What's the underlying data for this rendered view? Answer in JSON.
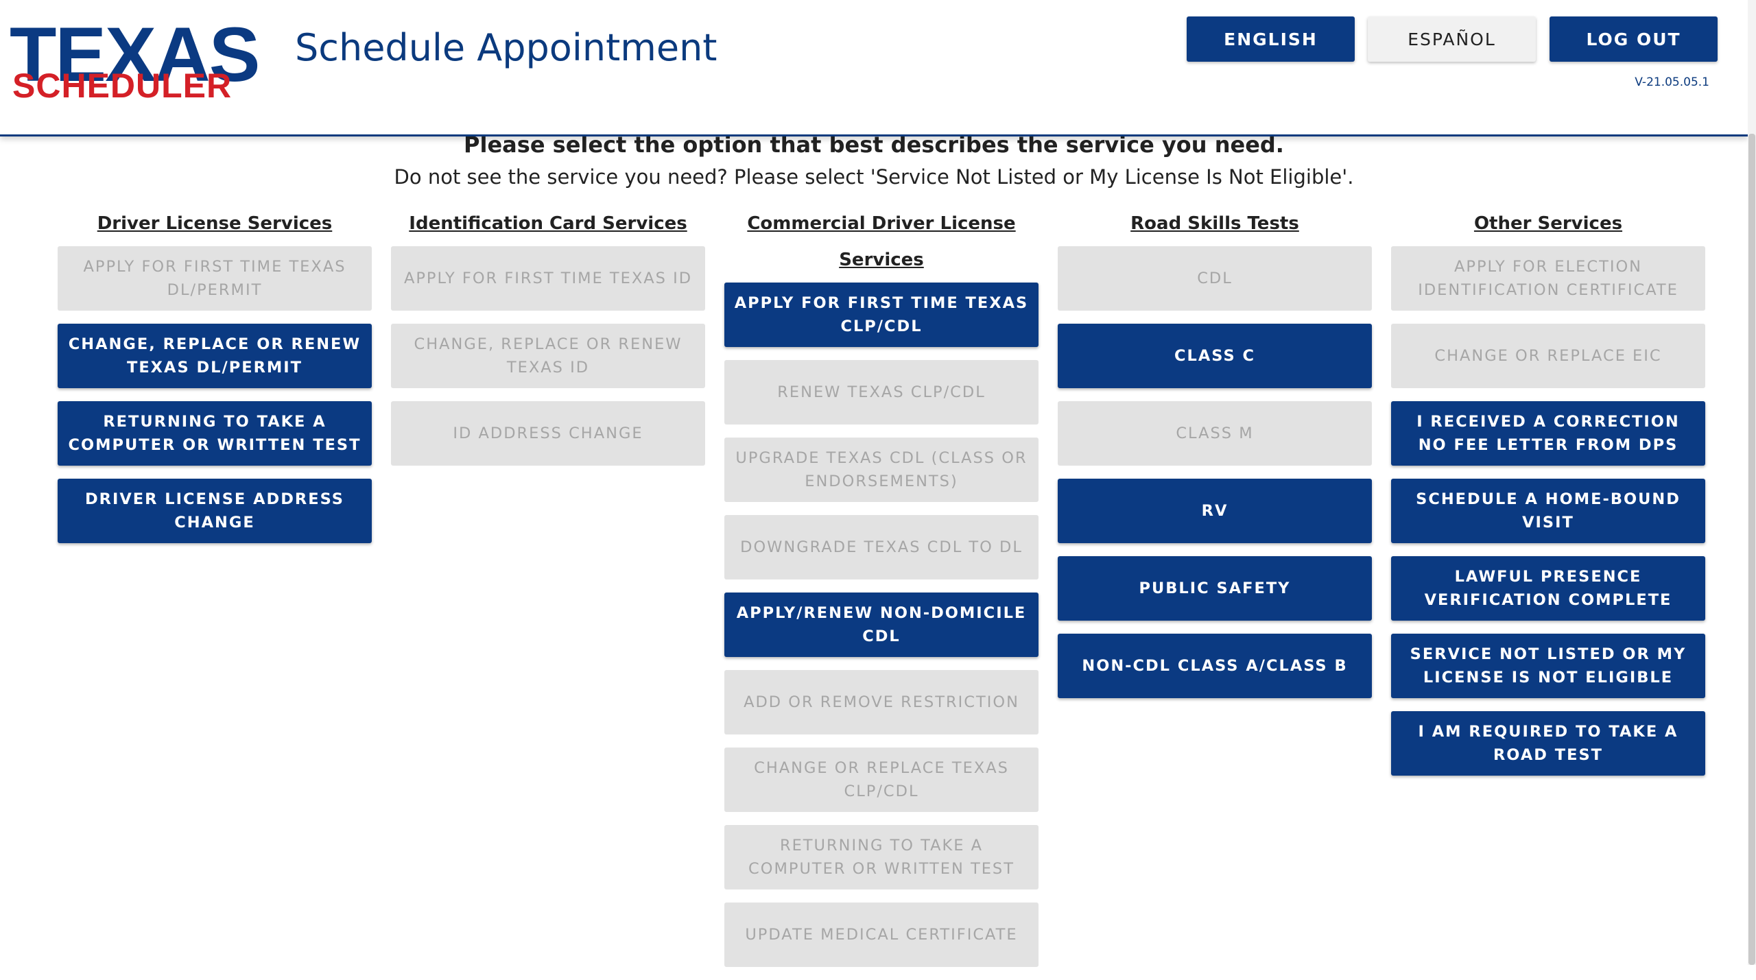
{
  "logo": {
    "line1": "TEXAS",
    "line2": "SCHEDULER"
  },
  "header": {
    "title": "Schedule Appointment",
    "english_label": "ENGLISH",
    "spanish_label": "ESPAÑOL",
    "logout_label": "LOG OUT",
    "version": "V-21.05.05.1"
  },
  "intro": {
    "prompt": "Please select the option that best describes the service you need.",
    "subprompt": "Do not see the service you need? Please select 'Service Not Listed or My License Is Not Eligible'."
  },
  "columns": [
    {
      "heading": "Driver License Services",
      "items": [
        {
          "label": "APPLY FOR FIRST TIME TEXAS DL/PERMIT",
          "enabled": false
        },
        {
          "label": "CHANGE, REPLACE OR RENEW TEXAS DL/PERMIT",
          "enabled": true
        },
        {
          "label": "RETURNING TO TAKE A COMPUTER OR WRITTEN TEST",
          "enabled": true
        },
        {
          "label": "DRIVER LICENSE ADDRESS CHANGE",
          "enabled": true
        }
      ]
    },
    {
      "heading": "Identification Card Services",
      "items": [
        {
          "label": "APPLY FOR FIRST TIME TEXAS ID",
          "enabled": false
        },
        {
          "label": "CHANGE, REPLACE OR RENEW TEXAS ID",
          "enabled": false
        },
        {
          "label": "ID ADDRESS CHANGE",
          "enabled": false
        }
      ]
    },
    {
      "heading": "Commercial Driver License Services",
      "items": [
        {
          "label": "APPLY FOR FIRST TIME TEXAS CLP/CDL",
          "enabled": true
        },
        {
          "label": "RENEW TEXAS CLP/CDL",
          "enabled": false
        },
        {
          "label": "UPGRADE TEXAS CDL (CLASS OR ENDORSEMENTS)",
          "enabled": false
        },
        {
          "label": "DOWNGRADE TEXAS CDL TO DL",
          "enabled": false
        },
        {
          "label": "APPLY/RENEW NON-DOMICILE CDL",
          "enabled": true
        },
        {
          "label": "ADD OR REMOVE RESTRICTION",
          "enabled": false
        },
        {
          "label": "CHANGE OR REPLACE TEXAS CLP/CDL",
          "enabled": false
        },
        {
          "label": "RETURNING TO TAKE A COMPUTER OR WRITTEN TEST",
          "enabled": false
        },
        {
          "label": "UPDATE MEDICAL CERTIFICATE",
          "enabled": false
        }
      ]
    },
    {
      "heading": "Road Skills Tests",
      "items": [
        {
          "label": "CDL",
          "enabled": false
        },
        {
          "label": "CLASS C",
          "enabled": true
        },
        {
          "label": "CLASS M",
          "enabled": false
        },
        {
          "label": "RV",
          "enabled": true
        },
        {
          "label": "PUBLIC SAFETY",
          "enabled": true
        },
        {
          "label": "NON-CDL CLASS A/CLASS B",
          "enabled": true
        }
      ]
    },
    {
      "heading": "Other Services",
      "items": [
        {
          "label": "APPLY FOR ELECTION IDENTIFICATION CERTIFICATE",
          "enabled": false
        },
        {
          "label": "CHANGE OR REPLACE EIC",
          "enabled": false
        },
        {
          "label": "I RECEIVED A CORRECTION NO FEE LETTER FROM DPS",
          "enabled": true
        },
        {
          "label": "SCHEDULE A HOME-BOUND VISIT",
          "enabled": true
        },
        {
          "label": "LAWFUL PRESENCE VERIFICATION COMPLETE",
          "enabled": true
        },
        {
          "label": "SERVICE NOT LISTED OR MY LICENSE IS NOT ELIGIBLE",
          "enabled": true
        },
        {
          "label": "I AM REQUIRED TO TAKE A ROAD TEST",
          "enabled": true
        }
      ]
    }
  ],
  "colors": {
    "primary": "#0b3a82",
    "disabled_bg": "#e2e2e2",
    "disabled_text": "#a6a6a6",
    "logo_red": "#d42027"
  }
}
